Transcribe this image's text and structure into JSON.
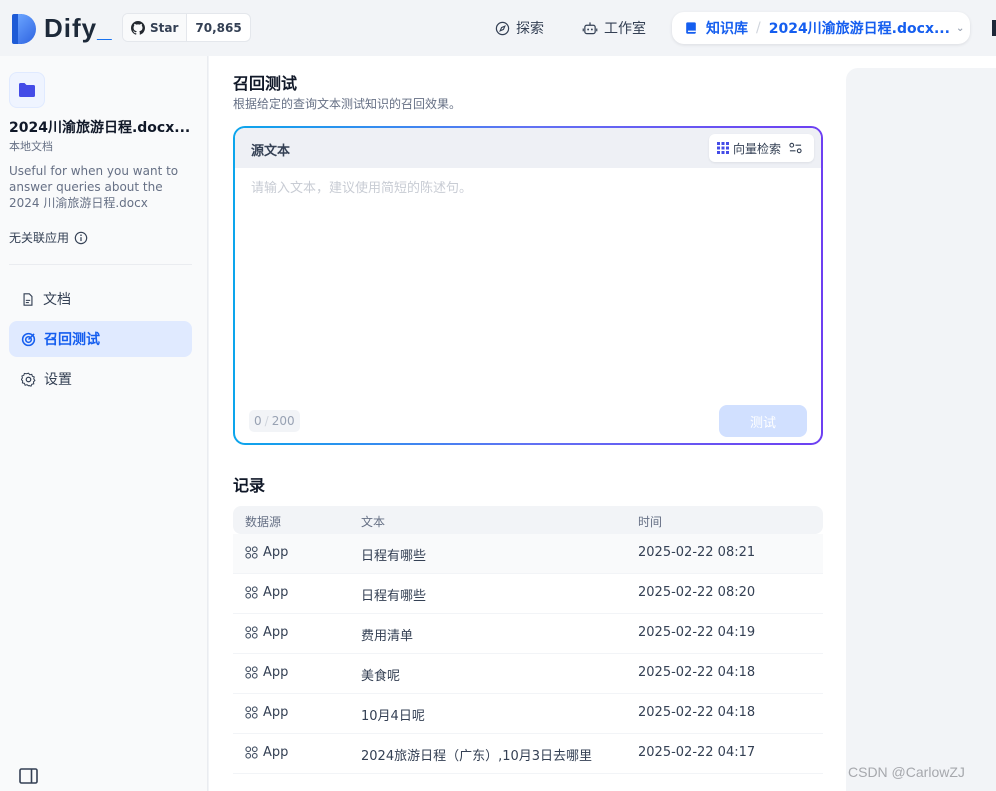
{
  "header": {
    "logo_text": "Dify",
    "star_label": "Star",
    "star_count": "70,865",
    "nav_explore": "探索",
    "nav_studio": "工作室",
    "kb_label": "知识库",
    "kb_separator": "/",
    "kb_current": "2024川渝旅游日程.docx..."
  },
  "sidebar": {
    "dataset_name": "2024川渝旅游日程.docx...",
    "dataset_type": "本地文档",
    "dataset_desc": "Useful for when you want to answer queries about the 2024 川渝旅游日程.docx",
    "no_linked_app": "无关联应用",
    "menu": [
      {
        "label": "文档",
        "icon": "document-icon"
      },
      {
        "label": "召回测试",
        "icon": "target-icon",
        "active": true
      },
      {
        "label": "设置",
        "icon": "gear-icon"
      }
    ]
  },
  "main": {
    "title": "召回测试",
    "description": "根据给定的查询文本测试知识的召回效果。",
    "query": {
      "header": "源文本",
      "method_label": "向量检索",
      "placeholder": "请输入文本，建议使用简短的陈述句。",
      "value": "",
      "counter_current": "0",
      "counter_sep": "/",
      "counter_max": "200",
      "test_button": "测试"
    },
    "records": {
      "title": "记录",
      "columns": [
        "数据源",
        "文本",
        "时间"
      ],
      "rows": [
        {
          "source": "App",
          "text": "日程有哪些",
          "time": "2025-02-22 08:21"
        },
        {
          "source": "App",
          "text": "日程有哪些",
          "time": "2025-02-22 08:20"
        },
        {
          "source": "App",
          "text": "费用清单",
          "time": "2025-02-22 04:19"
        },
        {
          "source": "App",
          "text": "美食呢",
          "time": "2025-02-22 04:18"
        },
        {
          "source": "App",
          "text": "10月4日呢",
          "time": "2025-02-22 04:18"
        },
        {
          "source": "App",
          "text": "2024旅游日程（广东）,10月3日去哪里",
          "time": "2025-02-22 04:17"
        }
      ]
    }
  },
  "watermark": "CSDN @CarlowZJ",
  "colors": {
    "accent": "#155eef",
    "active_bg": "#e0eaff",
    "test_button_disabled": "#d1e0ff"
  }
}
